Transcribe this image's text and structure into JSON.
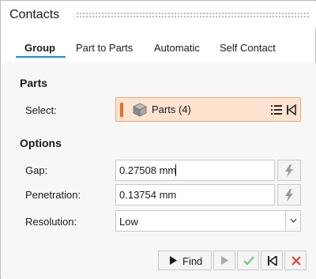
{
  "window": {
    "title": "Contacts"
  },
  "tabs": [
    {
      "label": "Group",
      "active": true
    },
    {
      "label": "Part to Parts",
      "active": false
    },
    {
      "label": "Automatic",
      "active": false
    },
    {
      "label": "Self Contact",
      "active": false
    }
  ],
  "parts": {
    "section_title": "Parts",
    "select_label": "Select:",
    "selector_text": "Parts (4)"
  },
  "options": {
    "section_title": "Options",
    "gap_label": "Gap:",
    "gap_value": "0.27508 mm",
    "penetration_label": "Penetration:",
    "penetration_value": "0.13754 mm",
    "resolution_label": "Resolution:",
    "resolution_value": "Low"
  },
  "actions": {
    "find_label": "Find"
  },
  "colors": {
    "accent_tab": "#1a8fcf",
    "selector_bg": "#fde3d0",
    "selector_bar": "#ee6a1e",
    "apply_green": "#7cc47c",
    "cancel_red": "#e0403a"
  },
  "icons": {
    "selector": "cube-icon",
    "list": "list-icon",
    "reset": "reset-selection-icon",
    "measure": "lightning-icon",
    "dropdown": "chevron-down-icon",
    "play": "play-icon",
    "next": "play-next-icon",
    "apply": "checkmark-icon",
    "exit": "exit-icon",
    "cancel": "close-icon"
  }
}
